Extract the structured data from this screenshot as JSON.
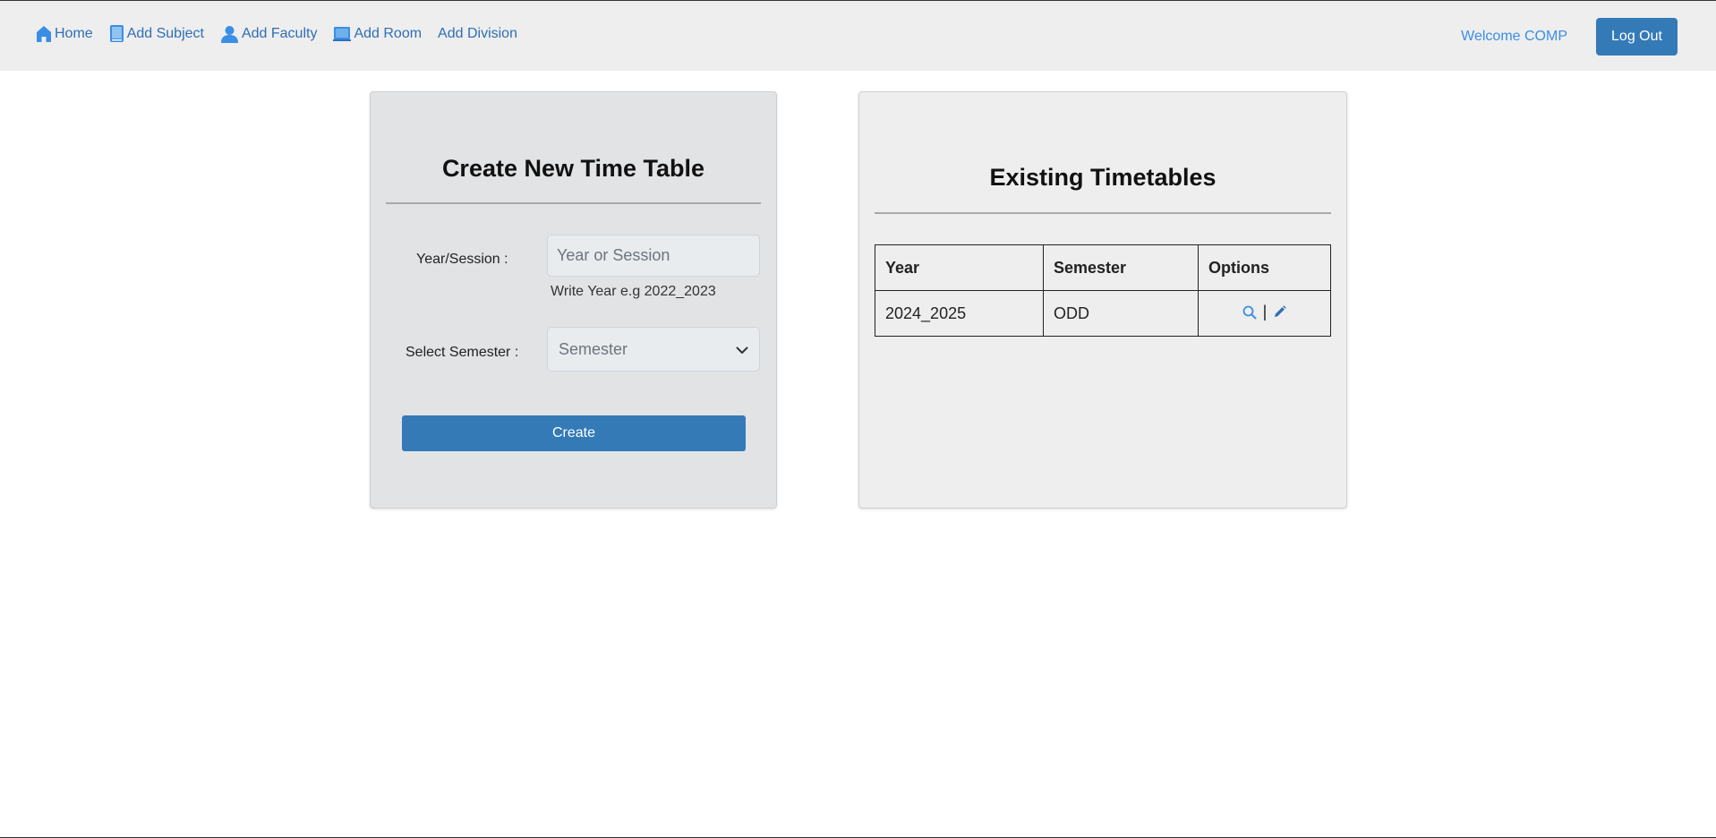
{
  "nav": {
    "items": [
      {
        "label": "Home",
        "icon": "home-icon"
      },
      {
        "label": "Add Subject",
        "icon": "book-icon"
      },
      {
        "label": "Add Faculty",
        "icon": "user-icon"
      },
      {
        "label": "Add Room",
        "icon": "room-icon"
      },
      {
        "label": "Add Division",
        "icon": ""
      }
    ],
    "welcome": "Welcome COMP",
    "logout_label": "Log Out"
  },
  "create_panel": {
    "title": "Create New Time Table",
    "year_label": "Year/Session :",
    "year_placeholder": "Year or Session",
    "year_value": "",
    "year_help": "Write Year e.g 2022_2023",
    "semester_label": "Select Semester :",
    "semester_selected": "Semester",
    "create_label": "Create"
  },
  "existing_panel": {
    "title": "Existing Timetables",
    "columns": [
      "Year",
      "Semester",
      "Options"
    ],
    "rows": [
      {
        "year": "2024_2025",
        "semester": "ODD",
        "separator": "|"
      }
    ]
  },
  "colors": {
    "accent": "#337ab7",
    "link": "#2f6eb5",
    "welcome": "#3a8ee6",
    "navbar_bg": "#eeeeee"
  }
}
